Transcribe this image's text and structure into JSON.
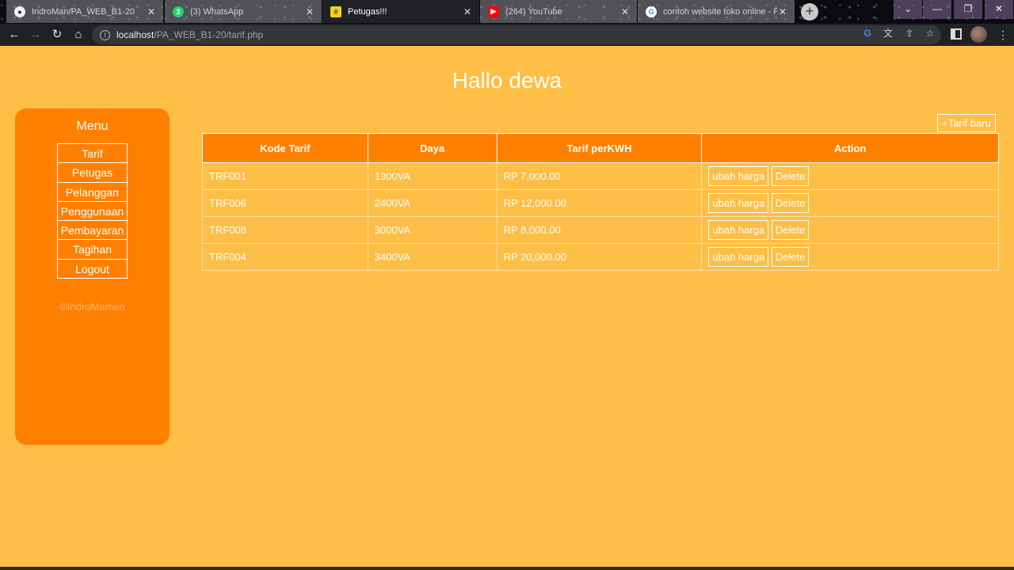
{
  "browser": {
    "tabs": [
      {
        "title": "IndroMan/PA_WEB_B1-20",
        "icon": "github-icon",
        "color": "#ffffff"
      },
      {
        "title": "(3) WhatsApp",
        "icon": "whatsapp-icon",
        "color": "#25D366"
      },
      {
        "title": "Petugas!!!",
        "icon": "hash-icon",
        "color": "#F2D11A",
        "active": true
      },
      {
        "title": "(264) YouTube",
        "icon": "youtube-icon",
        "color": "#FF0000"
      },
      {
        "title": "contoh website toko online - Pe",
        "icon": "google-icon",
        "color": "#4285F4"
      }
    ],
    "url_host": "localhost",
    "url_path": "/PA_WEB_B1-20/tarif.php"
  },
  "page": {
    "greeting": "Hallo dewa",
    "accent": "#FF8000",
    "background": "#FFBE46"
  },
  "sidebar": {
    "title": "Menu",
    "items": [
      {
        "label": "Tarif"
      },
      {
        "label": "Petugas"
      },
      {
        "label": "Pelanggan"
      },
      {
        "label": "Penggunaan"
      },
      {
        "label": "Pembayaran"
      },
      {
        "label": "Tagihan"
      },
      {
        "label": "Logout"
      }
    ],
    "copyright": "©IndroMamen"
  },
  "content": {
    "add_button": "+Tarif baru",
    "table": {
      "headers": [
        "Kode Tarif",
        "Daya",
        "Tarif perKWH",
        "Action"
      ],
      "edit_label": "ubah harga",
      "delete_label": "Delete",
      "rows": [
        {
          "kode": "TRF001",
          "daya": "1300VA",
          "tarif": "RP 7,000.00"
        },
        {
          "kode": "TRF006",
          "daya": "2400VA",
          "tarif": "RP 12,000.00"
        },
        {
          "kode": "TRF008",
          "daya": "3000VA",
          "tarif": "RP 8,000.00"
        },
        {
          "kode": "TRF004",
          "daya": "3400VA",
          "tarif": "RP 20,000.00"
        }
      ]
    }
  }
}
